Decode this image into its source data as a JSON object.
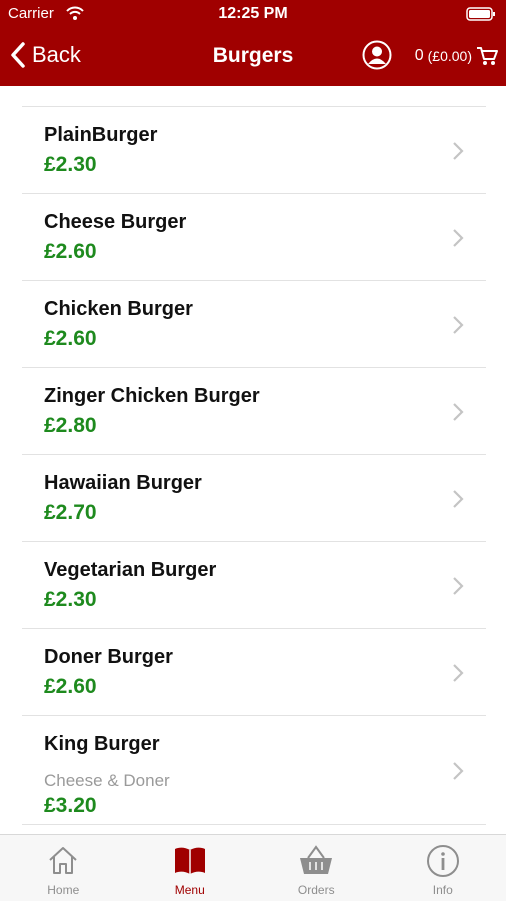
{
  "status_bar": {
    "carrier": "Carrier",
    "time": "12:25 PM"
  },
  "nav": {
    "back_label": "Back",
    "title": "Burgers",
    "cart_count": "0",
    "cart_total": "(£0.00)"
  },
  "items": [
    {
      "name": "PlainBurger",
      "price": "£2.30"
    },
    {
      "name": "Cheese Burger",
      "price": "£2.60"
    },
    {
      "name": "Chicken Burger",
      "price": "£2.60"
    },
    {
      "name": "Zinger Chicken Burger",
      "price": "£2.80"
    },
    {
      "name": "Hawaiian Burger",
      "price": "£2.70"
    },
    {
      "name": "Vegetarian Burger",
      "price": "£2.30"
    },
    {
      "name": "Doner Burger",
      "price": "£2.60"
    },
    {
      "name": "King Burger",
      "description": "Cheese & Doner",
      "price": "£3.20"
    }
  ],
  "tabs": [
    {
      "label": "Home",
      "icon": "home-icon"
    },
    {
      "label": "Menu",
      "icon": "book-icon",
      "active": true
    },
    {
      "label": "Orders",
      "icon": "basket-icon"
    },
    {
      "label": "Info",
      "icon": "info-icon"
    }
  ],
  "colors": {
    "brand": "#a00000",
    "price": "#1e8a1e"
  }
}
